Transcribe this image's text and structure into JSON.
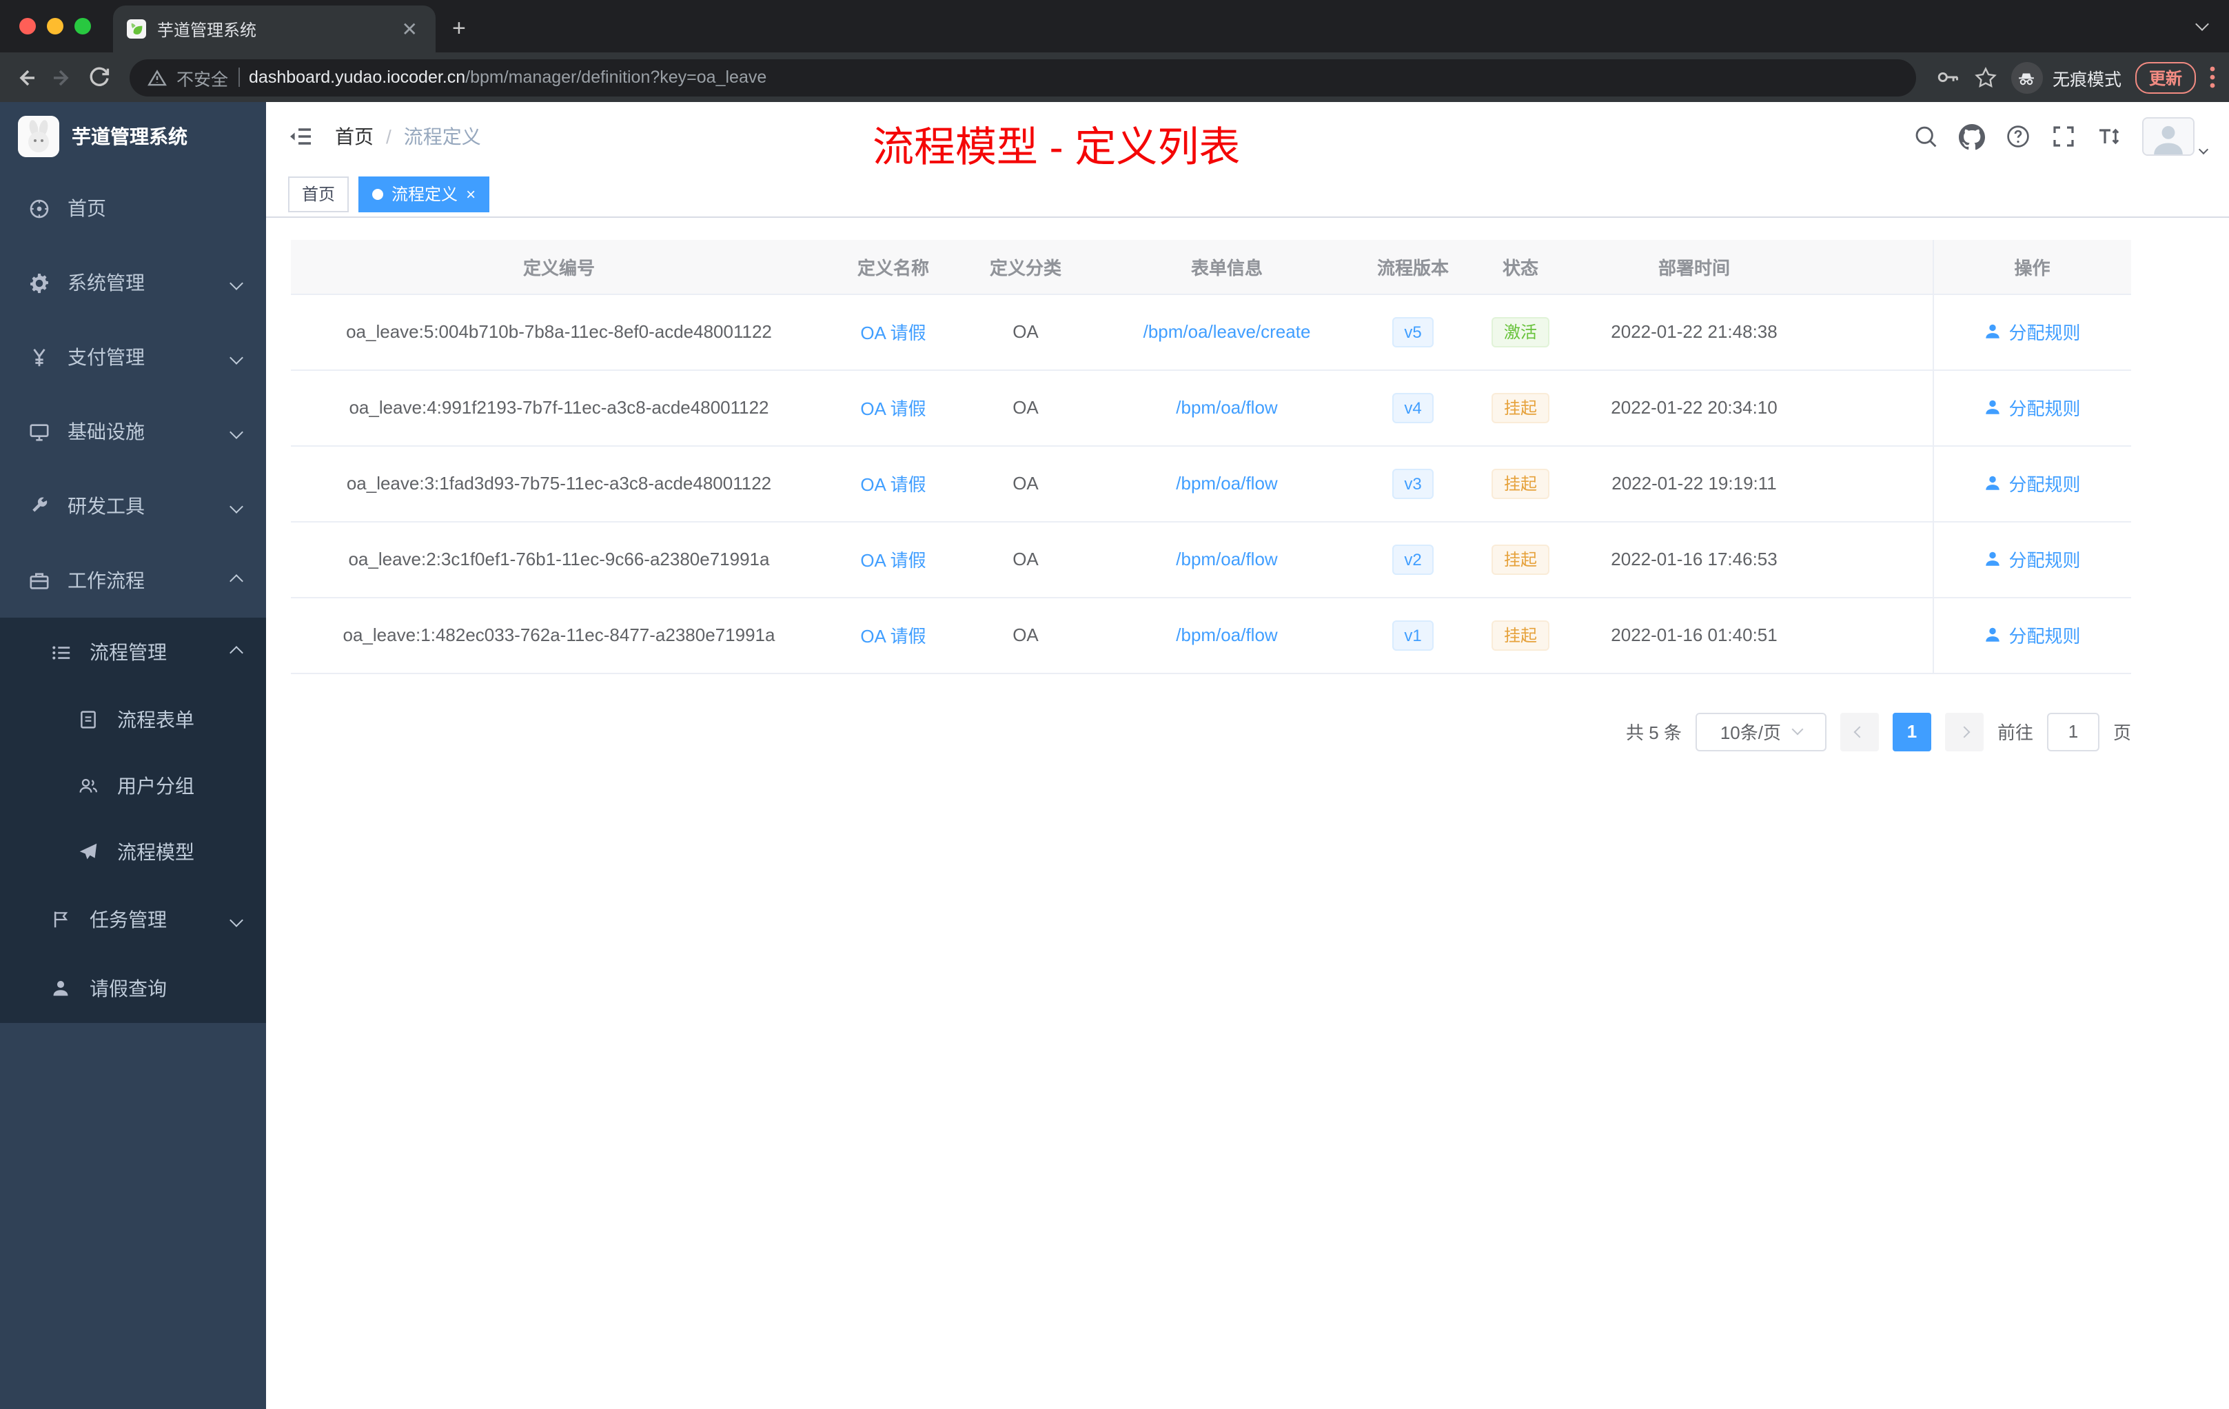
{
  "colors": {
    "accent": "#409eff",
    "success": "#67c23a",
    "warning": "#e6a23c",
    "annotation_red": "#f40606",
    "sidebar_bg": "#304156",
    "sidebar_sub_bg": "#1f2d3d"
  },
  "browser": {
    "tab_title": "芋道管理系统",
    "security_label": "不安全",
    "url_domain": "dashboard.yudao.iocoder.cn",
    "url_path": "/bpm/manager/definition?key=oa_leave",
    "incognito_label": "无痕模式",
    "update_label": "更新"
  },
  "sidebar": {
    "logo_title": "芋道管理系统",
    "items": [
      {
        "label": "首页"
      },
      {
        "label": "系统管理"
      },
      {
        "label": "支付管理"
      },
      {
        "label": "基础设施"
      },
      {
        "label": "研发工具"
      },
      {
        "label": "工作流程"
      }
    ],
    "children": [
      {
        "label": "流程管理"
      },
      {
        "label": "流程表单"
      },
      {
        "label": "用户分组"
      },
      {
        "label": "流程模型"
      },
      {
        "label": "任务管理"
      },
      {
        "label": "请假查询"
      }
    ]
  },
  "header": {
    "breadcrumb_home": "首页",
    "breadcrumb_sep": "/",
    "breadcrumb_current": "流程定义",
    "annotation": "流程模型 - 定义列表"
  },
  "tags": {
    "home": "首页",
    "active": "流程定义",
    "close": "×"
  },
  "table": {
    "columns": [
      "定义编号",
      "定义名称",
      "定义分类",
      "表单信息",
      "流程版本",
      "状态",
      "部署时间",
      "操作"
    ],
    "action_label": "分配规则",
    "rows": [
      {
        "id": "oa_leave:5:004b710b-7b8a-11ec-8ef0-acde48001122",
        "name": "OA 请假",
        "category": "OA",
        "form": "/bpm/oa/leave/create",
        "version": "v5",
        "status": "激活",
        "time": "2022-01-22 21:48:38"
      },
      {
        "id": "oa_leave:4:991f2193-7b7f-11ec-a3c8-acde48001122",
        "name": "OA 请假",
        "category": "OA",
        "form": "/bpm/oa/flow",
        "version": "v4",
        "status": "挂起",
        "time": "2022-01-22 20:34:10"
      },
      {
        "id": "oa_leave:3:1fad3d93-7b75-11ec-a3c8-acde48001122",
        "name": "OA 请假",
        "category": "OA",
        "form": "/bpm/oa/flow",
        "version": "v3",
        "status": "挂起",
        "time": "2022-01-22 19:19:11"
      },
      {
        "id": "oa_leave:2:3c1f0ef1-76b1-11ec-9c66-a2380e71991a",
        "name": "OA 请假",
        "category": "OA",
        "form": "/bpm/oa/flow",
        "version": "v2",
        "status": "挂起",
        "time": "2022-01-16 17:46:53"
      },
      {
        "id": "oa_leave:1:482ec033-762a-11ec-8477-a2380e71991a",
        "name": "OA 请假",
        "category": "OA",
        "form": "/bpm/oa/flow",
        "version": "v1",
        "status": "挂起",
        "time": "2022-01-16 01:40:51"
      }
    ]
  },
  "pagination": {
    "total": "共 5 条",
    "page_size": "10条/页",
    "page": "1",
    "goto_label": "前往",
    "goto_value": "1",
    "unit_label": "页"
  }
}
